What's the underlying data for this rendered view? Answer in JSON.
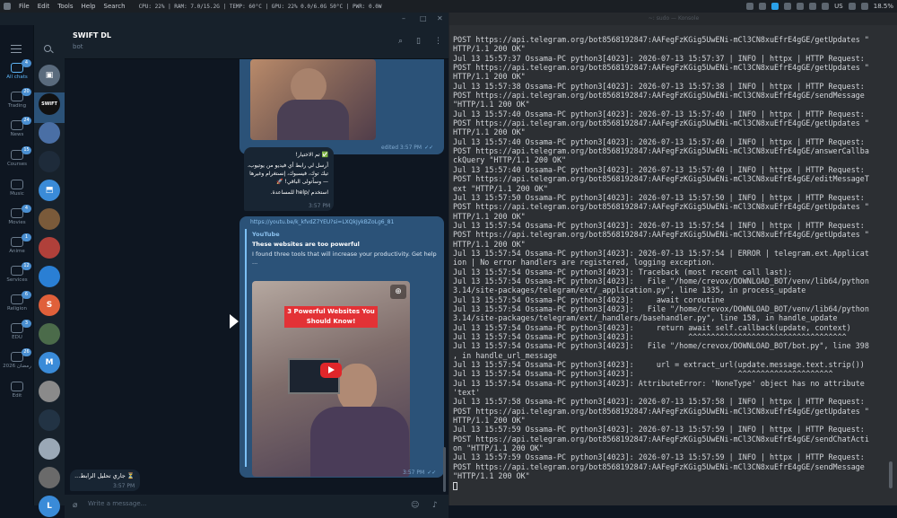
{
  "topbar": {
    "menu": [
      "File",
      "Edit",
      "Tools",
      "Help",
      "Search"
    ],
    "sys": "CPU: 22% | RAM: 7.0/15.2G | TEMP: 60°C | GPU: 22% 0.0/6.0G 50°C | PWR: 0.0W",
    "lang": "US",
    "battery": "18.5%",
    "accent_color": "#2aa0e8"
  },
  "telegram": {
    "folders": [
      {
        "label": "All chats",
        "badge": "4",
        "icon": "chat-bubbles-icon"
      },
      {
        "label": "Trading",
        "badge": "20",
        "icon": "folder-icon"
      },
      {
        "label": "News",
        "badge": "24",
        "icon": "folder-icon"
      },
      {
        "label": "Courses",
        "badge": "15",
        "icon": "folder-icon"
      },
      {
        "label": "Music",
        "badge": "",
        "icon": "folder-icon"
      },
      {
        "label": "Movies",
        "badge": "4",
        "icon": "folder-icon"
      },
      {
        "label": "Anime",
        "badge": "1",
        "icon": "folder-icon"
      },
      {
        "label": "Services",
        "badge": "12",
        "icon": "folder-icon"
      },
      {
        "label": "Religion",
        "badge": "6",
        "icon": "folder-icon"
      },
      {
        "label": "EDU",
        "badge": "3",
        "icon": "folder-icon"
      },
      {
        "label": "رمضان 2026",
        "badge": "26",
        "icon": "folder-icon"
      },
      {
        "label": "Edit",
        "badge": "",
        "icon": "sliders-icon"
      }
    ],
    "chats": [
      {
        "initials": "",
        "color": "#5a6b7d",
        "icon": "archive-icon"
      },
      {
        "initials": "SWIFT",
        "color": "#111111",
        "selected": true
      },
      {
        "initials": "",
        "color": "#4a6fa5"
      },
      {
        "initials": "",
        "color": "#1e2b3a"
      },
      {
        "initials": "",
        "color": "#3a8bd8",
        "icon": "bookmark-icon"
      },
      {
        "initials": "",
        "color": "#7a5a3a"
      },
      {
        "initials": "",
        "color": "#b0403a"
      },
      {
        "initials": "",
        "color": "#2a7fd4"
      },
      {
        "initials": "S",
        "color": "#e0603a"
      },
      {
        "initials": "",
        "color": "#4b6b4a"
      },
      {
        "initials": "M",
        "color": "#3a8bd8"
      },
      {
        "initials": "",
        "color": "#8a8a8a"
      },
      {
        "initials": "",
        "color": "#223344"
      },
      {
        "initials": "",
        "color": "#9aa8b6"
      },
      {
        "initials": "",
        "color": "#6a6a6a"
      },
      {
        "initials": "L",
        "color": "#3a8bd8"
      }
    ],
    "chat": {
      "title": "SWIFT DL",
      "subtitle": "bot",
      "msg1_meta": "edited 3:57 PM",
      "msg2_line1": "✅ تم الاختيار!",
      "msg2_line2": "أرسل لي رابط أي فيديو من يوتيوب، تيك توك، فيسبوك، إنستغرام وغيرها — وسأتولى الباقي! 🚀",
      "msg2_line3": "استخدم /help للمساعدة.",
      "msg2_time": "3:57 PM",
      "msg3_link": "https://youtu.be/k_kfvdZ7YEU?si=LXQkJykBZoLg6_81",
      "msg3_site": "YouTube",
      "msg3_title": "These websites are too powerful",
      "msg3_desc": "I found three tools that will increase your productivity. Get help ...",
      "msg3_thumb": "3 Powerful Websites You Should Know!",
      "msg3_time": "3:57 PM",
      "msg4_text": "⏳ جاري تحليل الرابط...",
      "msg4_time": "3:57 PM",
      "composer_placeholder": "Write a message..."
    }
  },
  "terminal": {
    "title": "~: sudo — Konsole",
    "lines": [
      "POST https://api.telegram.org/bot8568192847:AAFegFzKGig5UwENi-mCl3CN8xuEfrE4gGE/getUpdates \"",
      "HTTP/1.1 200 OK\"",
      "Jul 13 15:57:37 Ossama-PC python3[4023]: 2026-07-13 15:57:37 | INFO | httpx | HTTP Request:",
      "POST https://api.telegram.org/bot8568192847:AAFegFzKGig5UwENi-mCl3CN8xuEfrE4gGE/getUpdates \"",
      "HTTP/1.1 200 OK\"",
      "Jul 13 15:57:38 Ossama-PC python3[4023]: 2026-07-13 15:57:38 | INFO | httpx | HTTP Request:",
      "POST https://api.telegram.org/bot8568192847:AAFegFzKGig5UwENi-mCl3CN8xuEfrE4gGE/sendMessage",
      "\"HTTP/1.1 200 OK\"",
      "Jul 13 15:57:40 Ossama-PC python3[4023]: 2026-07-13 15:57:40 | INFO | httpx | HTTP Request:",
      "POST https://api.telegram.org/bot8568192847:AAFegFzKGig5UwENi-mCl3CN8xuEfrE4gGE/getUpdates \"",
      "HTTP/1.1 200 OK\"",
      "Jul 13 15:57:40 Ossama-PC python3[4023]: 2026-07-13 15:57:40 | INFO | httpx | HTTP Request:",
      "POST https://api.telegram.org/bot8568192847:AAFegFzKGig5UwENi-mCl3CN8xuEfrE4gGE/answerCallba",
      "ckQuery \"HTTP/1.1 200 OK\"",
      "Jul 13 15:57:40 Ossama-PC python3[4023]: 2026-07-13 15:57:40 | INFO | httpx | HTTP Request:",
      "POST https://api.telegram.org/bot8568192847:AAFegFzKGig5UwENi-mCl3CN8xuEfrE4gGE/editMessageT",
      "ext \"HTTP/1.1 200 OK\"",
      "Jul 13 15:57:50 Ossama-PC python3[4023]: 2026-07-13 15:57:50 | INFO | httpx | HTTP Request:",
      "POST https://api.telegram.org/bot8568192847:AAFegFzKGig5UwENi-mCl3CN8xuEfrE4gGE/getUpdates \"",
      "HTTP/1.1 200 OK\"",
      "Jul 13 15:57:54 Ossama-PC python3[4023]: 2026-07-13 15:57:54 | INFO | httpx | HTTP Request:",
      "POST https://api.telegram.org/bot8568192847:AAFegFzKGig5UwENi-mCl3CN8xuEfrE4gGE/getUpdates \"",
      "HTTP/1.1 200 OK\"",
      "Jul 13 15:57:54 Ossama-PC python3[4023]: 2026-07-13 15:57:54 | ERROR | telegram.ext.Applicat",
      "ion | No error handlers are registered, logging exception.",
      "Jul 13 15:57:54 Ossama-PC python3[4023]: Traceback (most recent call last):",
      "Jul 13 15:57:54 Ossama-PC python3[4023]:   File \"/home/crevox/DOWNLOAD_BOT/venv/lib64/python",
      "3.14/site-packages/telegram/ext/_application.py\", line 1335, in process_update",
      "Jul 13 15:57:54 Ossama-PC python3[4023]:     await coroutine",
      "Jul 13 15:57:54 Ossama-PC python3[4023]:   File \"/home/crevox/DOWNLOAD_BOT/venv/lib64/python",
      "3.14/site-packages/telegram/ext/_handlers/basehandler.py\", line 158, in handle_update",
      "Jul 13 15:57:54 Ossama-PC python3[4023]:     return await self.callback(update, context)",
      "Jul 13 15:57:54 Ossama-PC python3[4023]:            ^^^^^^^^^^^^^^^^^^^^^^^^^^^^^^^^^^^",
      "Jul 13 15:57:54 Ossama-PC python3[4023]:   File \"/home/crevox/DOWNLOAD_BOT/bot.py\", line 398",
      ", in handle_url_message",
      "Jul 13 15:57:54 Ossama-PC python3[4023]:     url = extract_url(update.message.text.strip())",
      "Jul 13 15:57:54 Ossama-PC python3[4023]:                       ^^^^^^^^^^^^^^^^^^^^^",
      "Jul 13 15:57:54 Ossama-PC python3[4023]: AttributeError: 'NoneType' object has no attribute",
      "'text'",
      "Jul 13 15:57:58 Ossama-PC python3[4023]: 2026-07-13 15:57:58 | INFO | httpx | HTTP Request:",
      "POST https://api.telegram.org/bot8568192847:AAFegFzKGig5UwENi-mCl3CN8xuEfrE4gGE/getUpdates \"",
      "HTTP/1.1 200 OK\"",
      "Jul 13 15:57:59 Ossama-PC python3[4023]: 2026-07-13 15:57:59 | INFO | httpx | HTTP Request:",
      "POST https://api.telegram.org/bot8568192847:AAFegFzKGig5UwENi-mCl3CN8xuEfrE4gGE/sendChatActi",
      "on \"HTTP/1.1 200 OK\"",
      "Jul 13 15:57:59 Ossama-PC python3[4023]: 2026-07-13 15:57:59 | INFO | httpx | HTTP Request:",
      "POST https://api.telegram.org/bot8568192847:AAFegFzKGig5UwENi-mCl3CN8xuEfrE4gGE/sendMessage",
      "\"HTTP/1.1 200 OK\""
    ]
  }
}
